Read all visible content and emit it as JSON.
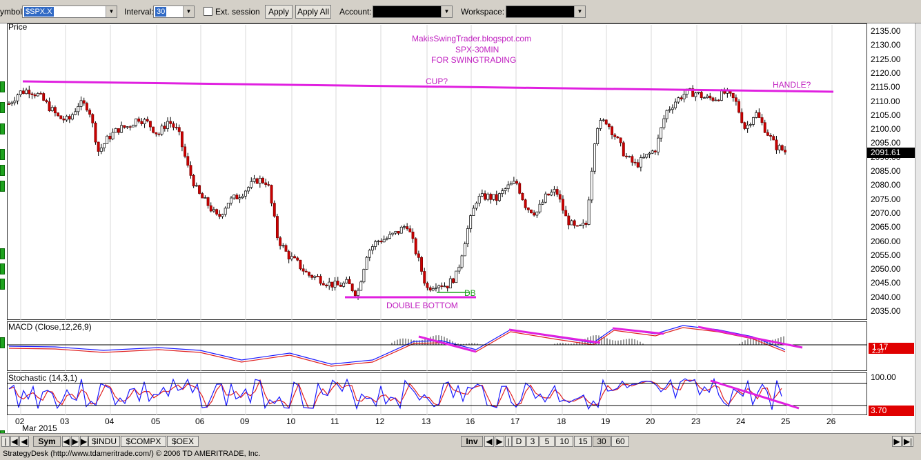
{
  "toolbar": {
    "symbol_label": "ymbol:",
    "symbol_value": "$SPX.X",
    "interval_label": "Interval:",
    "interval_value": "30",
    "ext_session_label": "Ext. session",
    "apply_label": "Apply",
    "apply_all_label": "Apply All",
    "account_label": "Account:",
    "workspace_label": "Workspace:"
  },
  "price_panel": {
    "title": "Price",
    "axis_ticks": [
      "2135.00",
      "2130.00",
      "2125.00",
      "2120.00",
      "2115.00",
      "2110.00",
      "2105.00",
      "2100.00",
      "2095.00",
      "2090.00",
      "2085.00",
      "2080.00",
      "2075.00",
      "2070.00",
      "2065.00",
      "2060.00",
      "2055.00",
      "2050.00",
      "2045.00",
      "2040.00",
      "2035.00"
    ],
    "last_price": "2091.61",
    "annotations": {
      "line1": "MakisSwingTrader.blogspot.com",
      "line2": "SPX-30MIN",
      "line3": "FOR SWINGTRADING",
      "cup": "CUP?",
      "handle": "HANDLE?",
      "double_bottom": "DOUBLE BOTTOM",
      "db": "DB"
    }
  },
  "macd_panel": {
    "title": "MACD (Close,12,26,9)",
    "value_a": "1.17",
    "value_b": "2.37"
  },
  "stoch_panel": {
    "title": "Stochastic (14,3,1)",
    "level_top": "100.00",
    "value": "3.70"
  },
  "x_axis": {
    "labels": [
      "02",
      "03",
      "04",
      "05",
      "06",
      "09",
      "10",
      "11",
      "12",
      "13",
      "16",
      "17",
      "18",
      "19",
      "20",
      "23",
      "24",
      "25",
      "26"
    ],
    "month": "Mar 2015"
  },
  "bottombar": {
    "sym_label": "Sym",
    "tabs": [
      "$INDU",
      "$COMPX",
      "$OEX"
    ],
    "inv_label": "Inv",
    "d_label": "D",
    "intervals": [
      "3",
      "5",
      "10",
      "15",
      "30",
      "60"
    ]
  },
  "status": "StrategyDesk (http://www.tdameritrade.com/) © 2006 TD AMERITRADE, Inc.",
  "colors": {
    "up": "#ffffff",
    "down": "#cc0000",
    "annotation": "#e020e0",
    "macd": "#1a1aff",
    "signal": "#e02020"
  },
  "chart_data": {
    "type": "candlestick",
    "title": "Price",
    "ylim": [
      2033,
      2138
    ],
    "x_labels": [
      "02",
      "03",
      "04",
      "05",
      "06",
      "09",
      "10",
      "11",
      "12",
      "13",
      "16",
      "17",
      "18",
      "19",
      "20",
      "23",
      "24",
      "25",
      "26"
    ],
    "close_path": [
      2109,
      2113,
      2114,
      2112,
      2108,
      2104,
      2103,
      2109,
      2108,
      2092,
      2097,
      2100,
      2101,
      2104,
      2102,
      2098,
      2103,
      2099,
      2086,
      2077,
      2073,
      2068,
      2074,
      2076,
      2079,
      2082,
      2081,
      2061,
      2055,
      2052,
      2048,
      2047,
      2045,
      2044,
      2045,
      2041,
      2056,
      2060,
      2061,
      2063,
      2066,
      2055,
      2043,
      2045,
      2044,
      2048,
      2063,
      2075,
      2076,
      2075,
      2079,
      2081,
      2072,
      2070,
      2076,
      2078,
      2068,
      2064,
      2066,
      2101,
      2103,
      2097,
      2090,
      2087,
      2090,
      2093,
      2106,
      2110,
      2113,
      2113,
      2111,
      2111,
      2113,
      2110,
      2100,
      2106,
      2100,
      2094,
      2092
    ]
  }
}
